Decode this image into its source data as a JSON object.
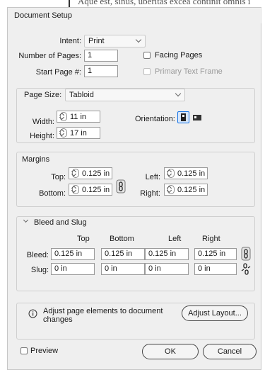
{
  "background_text": "Aque est, sinus, uberitas excea continit omnis i",
  "dialog": {
    "title": "Document Setup",
    "intent_label": "Intent:",
    "intent_value": "Print",
    "pages_label": "Number of Pages:",
    "pages_value": "1",
    "facing_pages_label": "Facing Pages",
    "facing_pages_checked": false,
    "start_page_label": "Start Page #:",
    "start_page_value": "1",
    "primary_text_frame_label": "Primary Text Frame",
    "primary_text_frame_checked": false
  },
  "page_size": {
    "label": "Page Size:",
    "value": "Tabloid",
    "width_label": "Width:",
    "width_value": "11 in",
    "height_label": "Height:",
    "height_value": "17 in",
    "orientation_label": "Orientation:",
    "orientation_selected": "portrait"
  },
  "margins": {
    "group_label": "Margins",
    "top_label": "Top:",
    "top_value": "0.125 in",
    "bottom_label": "Bottom:",
    "bottom_value": "0.125 in",
    "left_label": "Left:",
    "left_value": "0.125 in",
    "right_label": "Right:",
    "right_value": "0.125 in",
    "linked": true
  },
  "bleed_slug": {
    "section_label": "Bleed and Slug",
    "expanded": true,
    "col_top": "Top",
    "col_bottom": "Bottom",
    "col_left": "Left",
    "col_right": "Right",
    "bleed_label": "Bleed:",
    "bleed": [
      "0.125 in",
      "0.125 in",
      "0.125 in",
      "0.125 in"
    ],
    "bleed_linked": true,
    "slug_label": "Slug:",
    "slug": [
      "0 in",
      "0 in",
      "0 in",
      "0 in"
    ],
    "slug_linked": false
  },
  "adjust": {
    "info_text": "Adjust page elements to document changes",
    "button_label": "Adjust Layout..."
  },
  "footer": {
    "preview_label": "Preview",
    "preview_checked": false,
    "ok_label": "OK",
    "cancel_label": "Cancel"
  },
  "colors": {
    "dialog_bg": "#efefef",
    "field_border": "#9a9a9a",
    "selected_orientation": "#1473e6"
  }
}
